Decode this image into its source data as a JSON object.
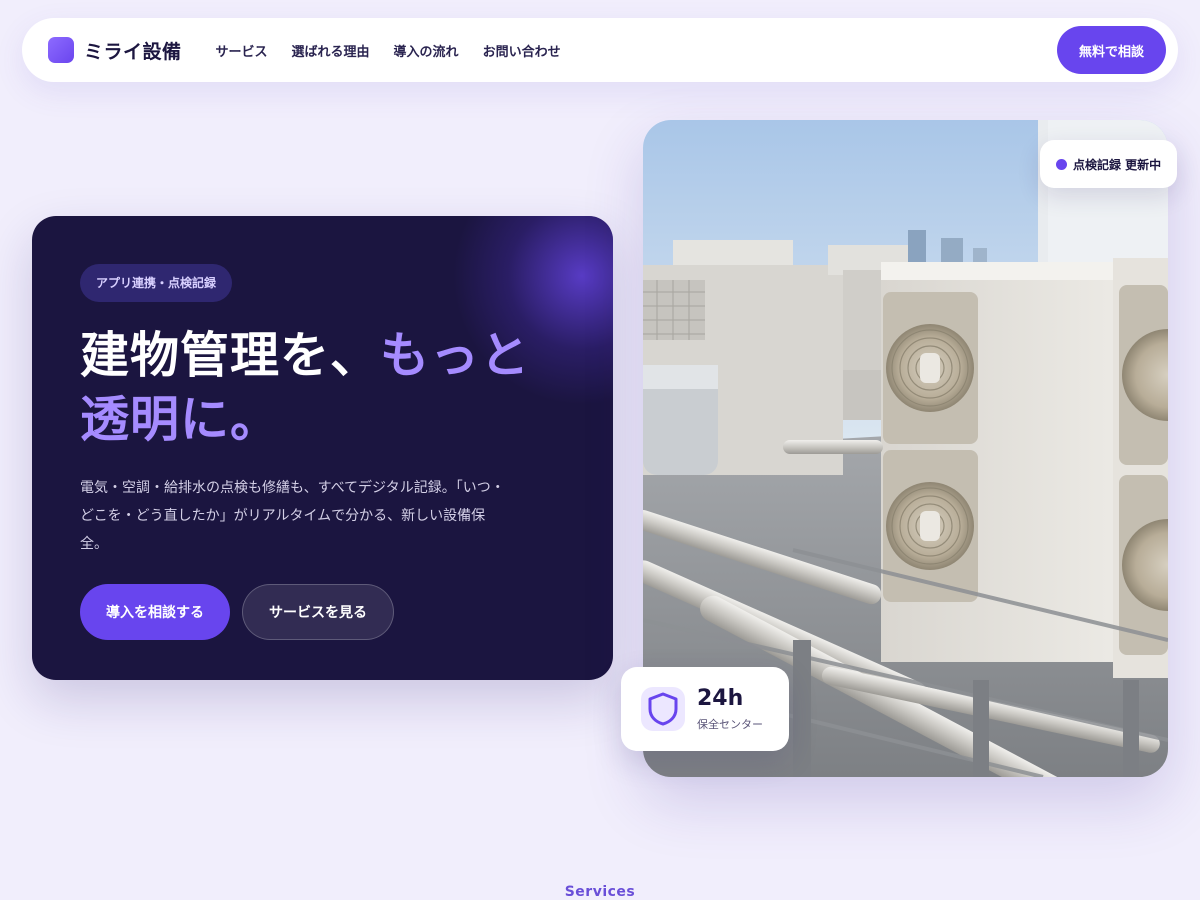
{
  "header": {
    "brand": "ミライ設備",
    "nav": [
      "サービス",
      "選ばれる理由",
      "導入の流れ",
      "お問い合わせ"
    ],
    "cta": "無料で相談"
  },
  "hero": {
    "pill": "アプリ連携・点検記録",
    "headline_white": "建物管理を、",
    "headline_accent_1": "もっと",
    "headline_accent_2": "透明に。",
    "description": "電気・空調・給排水の点検も修繕も、すべてデジタル記録。「いつ・どこを・どう直したか」がリアルタイムで分かる、新しい設備保全。",
    "primary_button": "導入を相談する",
    "secondary_button": "サービスを見る"
  },
  "photo": {
    "status_badge": "点検記録 更新中",
    "stat_value": "24h",
    "stat_label": "保全センター"
  },
  "sections": {
    "services_label": "Services"
  },
  "colors": {
    "accent": "#6845ee",
    "accent_light": "#a58bff",
    "hero_bg": "#1b1540",
    "page_bg": "#f1eefc"
  },
  "icons": {
    "status_dot": "dot-icon",
    "stat_icon": "shield-icon",
    "brand_mark": "logo-mark"
  }
}
